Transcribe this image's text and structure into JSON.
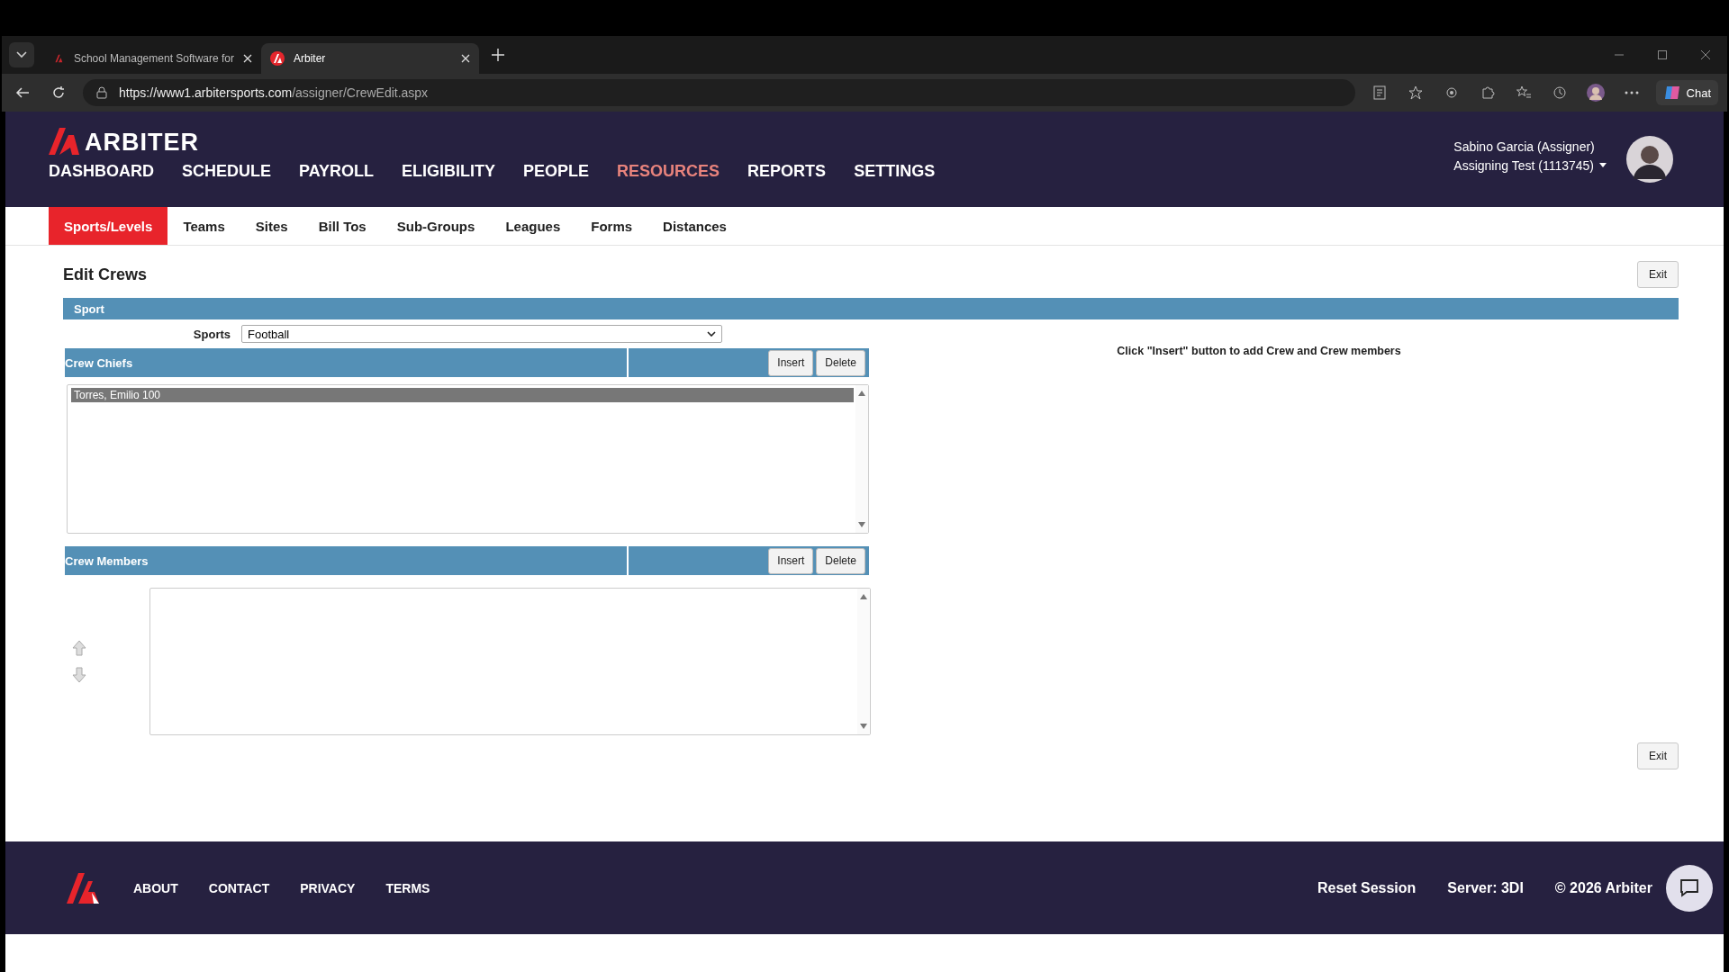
{
  "browser": {
    "tabs": [
      {
        "title": "School Management Software for",
        "selected": false
      },
      {
        "title": "Arbiter",
        "selected": true
      }
    ],
    "url_host": "https://www1.arbitersports.com",
    "url_path": "/assigner/CrewEdit.aspx",
    "chat_label": "Chat"
  },
  "header": {
    "logo": "ARBITER",
    "user_name": "Sabino Garcia (Assigner)",
    "account": "Assigning Test (1113745)",
    "nav": [
      {
        "label": "DASHBOARD",
        "selected": false
      },
      {
        "label": "SCHEDULE",
        "selected": false
      },
      {
        "label": "PAYROLL",
        "selected": false
      },
      {
        "label": "ELIGIBILITY",
        "selected": false
      },
      {
        "label": "PEOPLE",
        "selected": false
      },
      {
        "label": "RESOURCES",
        "selected": true
      },
      {
        "label": "REPORTS",
        "selected": false
      },
      {
        "label": "SETTINGS",
        "selected": false
      }
    ]
  },
  "subnav": [
    {
      "label": "Sports/Levels",
      "selected": true
    },
    {
      "label": "Teams",
      "selected": false
    },
    {
      "label": "Sites",
      "selected": false
    },
    {
      "label": "Bill Tos",
      "selected": false
    },
    {
      "label": "Sub-Groups",
      "selected": false
    },
    {
      "label": "Leagues",
      "selected": false
    },
    {
      "label": "Forms",
      "selected": false
    },
    {
      "label": "Distances",
      "selected": false
    }
  ],
  "page": {
    "title": "Edit Crews",
    "exit_label": "Exit",
    "section": "Sport",
    "sports_label": "Sports",
    "sports_value": "Football",
    "crew_chiefs": {
      "title": "Crew Chiefs",
      "insert": "Insert",
      "delete": "Delete",
      "items": [
        {
          "name": "Torres, Emilio 100",
          "selected": true
        }
      ]
    },
    "crew_members": {
      "title": "Crew Members",
      "insert": "Insert",
      "delete": "Delete"
    },
    "hint": "Click \"Insert\" button to add Crew and Crew members",
    "bottom_exit_label": "Exit"
  },
  "footer": {
    "links": [
      "ABOUT",
      "CONTACT",
      "PRIVACY",
      "TERMS"
    ],
    "reset": "Reset Session",
    "server": "Server: 3DI",
    "copyright": "© 2026 Arbiter"
  }
}
